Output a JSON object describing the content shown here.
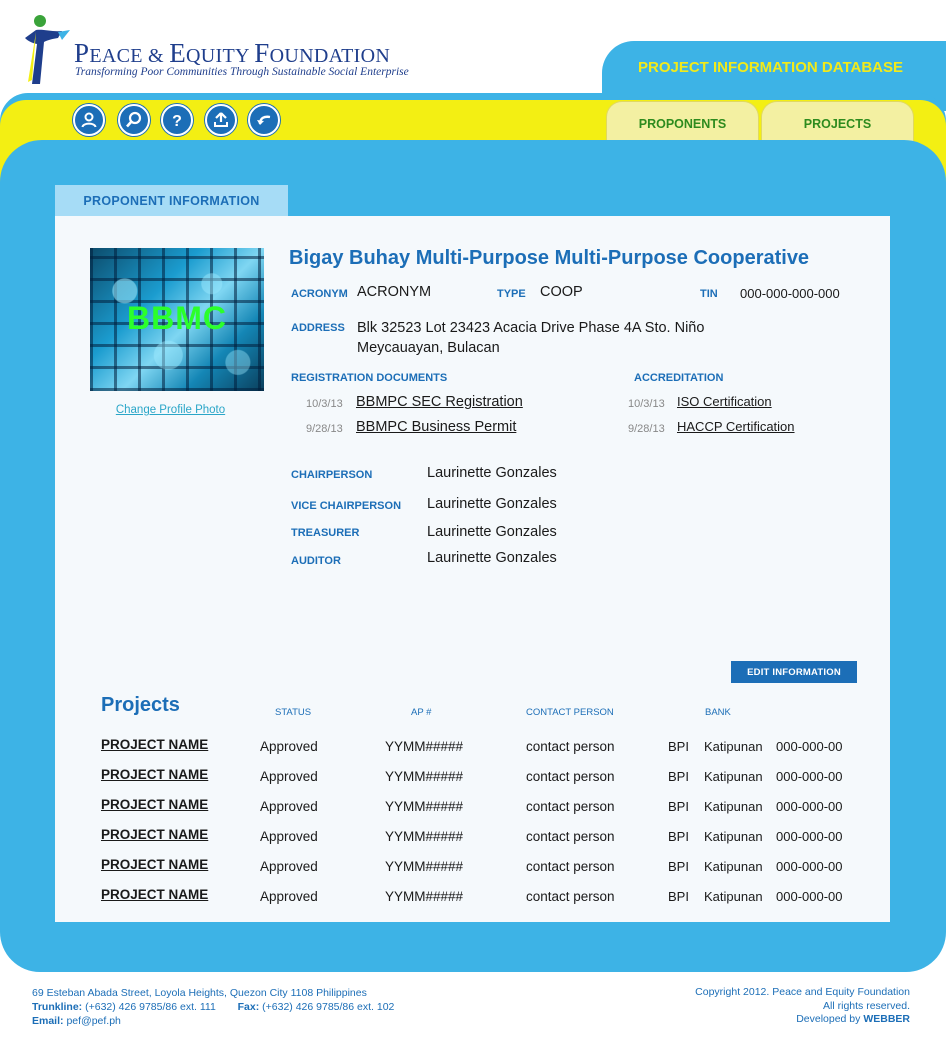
{
  "brand": {
    "name_first": "P",
    "name_rest_1": "EACE & ",
    "name_e": "E",
    "name_rest_2": "QUITY ",
    "name_f": "F",
    "name_rest_3": "OUNDATION",
    "tagline": "Transforming Poor Communities Through Sustainable Social Enterprise"
  },
  "header": {
    "db_title": "PROJECT INFORMATION DATABASE"
  },
  "toolbar": {
    "icons": [
      "user-icon",
      "search-icon",
      "help-icon",
      "upload-icon",
      "back-icon"
    ]
  },
  "nav": {
    "tabs": [
      {
        "label": "PROPONENTS"
      },
      {
        "label": "PROJECTS"
      }
    ]
  },
  "section": {
    "title": "PROPONENT INFORMATION"
  },
  "proponent": {
    "photo_text": "BBMC",
    "change_photo": "Change Profile Photo",
    "name": "Bigay Buhay Multi-Purpose Multi-Purpose Cooperative",
    "acronym_label": "ACRONYM",
    "acronym": "ACRONYM",
    "type_label": "TYPE",
    "type": "COOP",
    "tin_label": "TIN",
    "tin": "000-000-000-000",
    "address_label": "ADDRESS",
    "address_line1": "Blk 32523 Lot 23423 Acacia Drive Phase 4A Sto. Niño",
    "address_line2": "Meycauayan, Bulacan",
    "reg_docs_label": "REGISTRATION DOCUMENTS",
    "reg_docs": [
      {
        "date": "10/3/13",
        "name": "BBMPC SEC Registration"
      },
      {
        "date": "9/28/13",
        "name": "BBMPC Business Permit"
      }
    ],
    "accreditation_label": "ACCREDITATION",
    "accreditations": [
      {
        "date": "10/3/13",
        "name": "ISO Certification"
      },
      {
        "date": "9/28/13",
        "name": "HACCP Certification"
      }
    ],
    "officers": [
      {
        "role": "CHAIRPERSON",
        "name": "Laurinette Gonzales"
      },
      {
        "role": "VICE CHAIRPERSON",
        "name": "Laurinette Gonzales"
      },
      {
        "role": "TREASURER",
        "name": "Laurinette Gonzales"
      },
      {
        "role": "AUDITOR",
        "name": "Laurinette Gonzales"
      }
    ],
    "edit_button": "EDIT INFORMATION"
  },
  "projects": {
    "title": "Projects",
    "headers": {
      "status": "STATUS",
      "ap": "AP #",
      "contact": "CONTACT PERSON",
      "bank": "BANK"
    },
    "rows": [
      {
        "name": "PROJECT NAME",
        "status": "Approved",
        "ap": "YYMM#####",
        "contact": "contact person",
        "bank": "BPI",
        "branch": "Katipunan",
        "account": "000-000-00"
      },
      {
        "name": "PROJECT NAME",
        "status": "Approved",
        "ap": "YYMM#####",
        "contact": "contact person",
        "bank": "BPI",
        "branch": "Katipunan",
        "account": "000-000-00"
      },
      {
        "name": "PROJECT NAME",
        "status": "Approved",
        "ap": "YYMM#####",
        "contact": "contact person",
        "bank": "BPI",
        "branch": "Katipunan",
        "account": "000-000-00"
      },
      {
        "name": "PROJECT NAME",
        "status": "Approved",
        "ap": "YYMM#####",
        "contact": "contact person",
        "bank": "BPI",
        "branch": "Katipunan",
        "account": "000-000-00"
      },
      {
        "name": "PROJECT NAME",
        "status": "Approved",
        "ap": "YYMM#####",
        "contact": "contact person",
        "bank": "BPI",
        "branch": "Katipunan",
        "account": "000-000-00"
      },
      {
        "name": "PROJECT NAME",
        "status": "Approved",
        "ap": "YYMM#####",
        "contact": "contact person",
        "bank": "BPI",
        "branch": "Katipunan",
        "account": "000-000-00"
      }
    ]
  },
  "footer": {
    "address": "69 Esteban Abada Street, Loyola Heights, Quezon City 1108 Philippines",
    "trunkline_label": "Trunkline:",
    "trunkline": "(+632) 426 9785/86 ext. 111",
    "fax_label": "Fax:",
    "fax": "(+632) 426 9785/86 ext. 102",
    "email_label": "Email:",
    "email": "pef@pef.ph",
    "copyright": "Copyright 2012. Peace and Equity Foundation",
    "rights": "All rights reserved.",
    "developed_by": "Developed by",
    "developer": "WEBBER"
  },
  "colors": {
    "brand_blue": "#1c6eb7",
    "panel_blue": "#3db3e6",
    "band_yellow": "#f3ef13",
    "tab_green": "#2e8b1e"
  }
}
